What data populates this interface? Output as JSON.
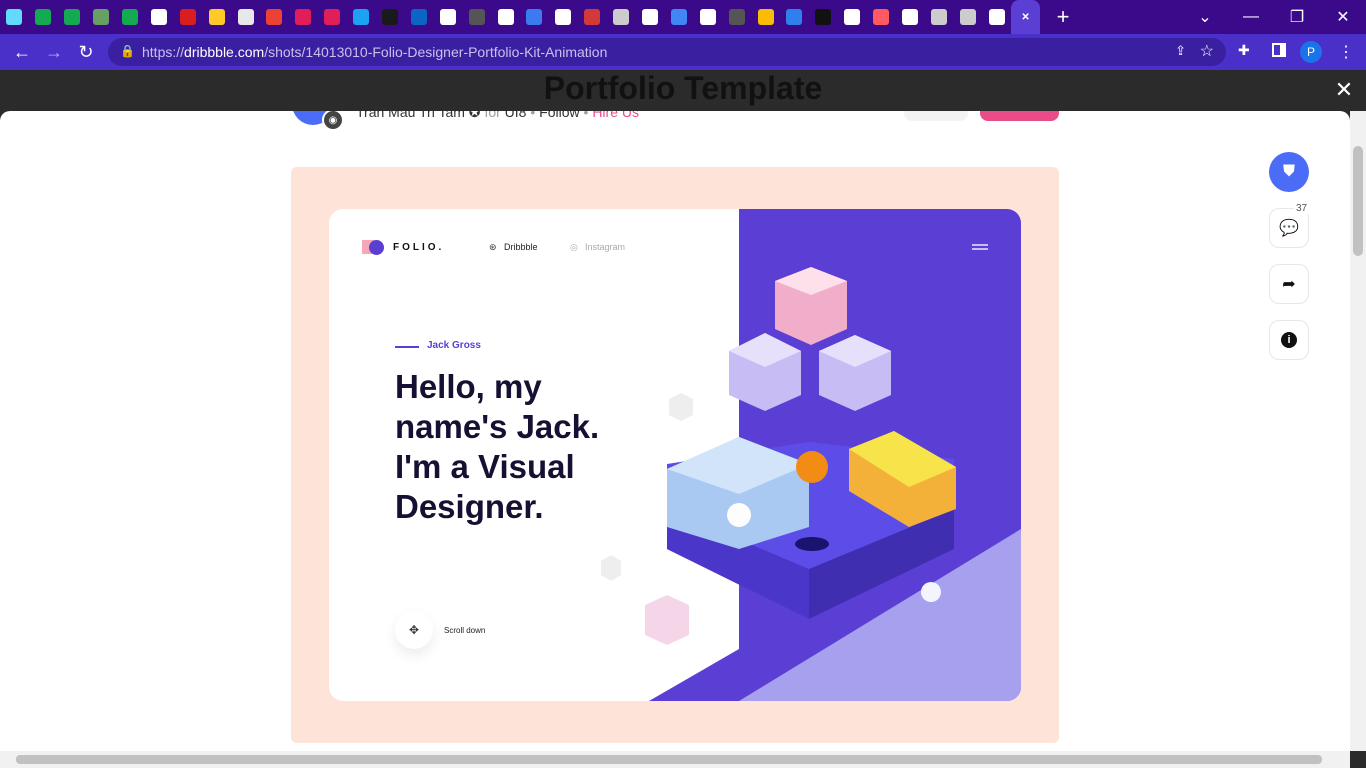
{
  "browser": {
    "url_host": "dribbble.com",
    "url_prefix": "https://",
    "url_path": "/shots/14013010-Folio-Designer-Portfolio-Kit-Animation"
  },
  "tabs": [
    {
      "icon": "react-icon",
      "color": "#61dafb"
    },
    {
      "icon": "mongodb-icon",
      "color": "#13aa52"
    },
    {
      "icon": "mongodb-icon",
      "color": "#13aa52"
    },
    {
      "icon": "nodejs-icon",
      "color": "#68a063"
    },
    {
      "icon": "mongodb-icon",
      "color": "#13aa52"
    },
    {
      "icon": "google-icon",
      "color": "#ffffff"
    },
    {
      "icon": "netlify-icon",
      "color": "#d81e1e"
    },
    {
      "icon": "firebase-icon",
      "color": "#ffca28"
    },
    {
      "icon": "store-icon",
      "color": "#e8e8e8"
    },
    {
      "icon": "gmail-icon",
      "color": "#ea4335"
    },
    {
      "icon": "slack-icon",
      "color": "#e01e5a"
    },
    {
      "icon": "slack-icon",
      "color": "#e01e5a"
    },
    {
      "icon": "twitter-icon",
      "color": "#1da1f2"
    },
    {
      "icon": "github-icon",
      "color": "#1a1a1a"
    },
    {
      "icon": "linkedin-icon",
      "color": "#0a66c2"
    },
    {
      "icon": "globe-icon",
      "color": "#ffffff"
    },
    {
      "icon": "github-icon",
      "color": "#555555"
    },
    {
      "icon": "circle-icon",
      "color": "#ffffff"
    },
    {
      "icon": "p-icon",
      "color": "#3a7bf0"
    },
    {
      "icon": "m-icon",
      "color": "#ffffff"
    },
    {
      "icon": "codepen-icon",
      "color": "#d23a3a"
    },
    {
      "icon": "hacker-icon",
      "color": "#cccccc"
    },
    {
      "icon": "codesandbox-icon",
      "color": "#ffffff"
    },
    {
      "icon": "docs-icon",
      "color": "#4285f4"
    },
    {
      "icon": "book-icon",
      "color": "#ffffff"
    },
    {
      "icon": "github-icon",
      "color": "#555555"
    },
    {
      "icon": "drive-icon",
      "color": "#fbbc05"
    },
    {
      "icon": "c-icon",
      "color": "#2f80ed"
    },
    {
      "icon": "android-icon",
      "color": "#111111"
    },
    {
      "icon": "google-icon",
      "color": "#ffffff"
    },
    {
      "icon": "asterisk-icon",
      "color": "#ff5a5f"
    },
    {
      "icon": "flag-icon",
      "color": "#ffffff"
    },
    {
      "icon": "hacker-icon",
      "color": "#cccccc"
    },
    {
      "icon": "globe-icon",
      "color": "#cccccc"
    },
    {
      "icon": "medium-icon",
      "color": "#ffffff"
    },
    {
      "icon": "close-icon",
      "color": "#ffffff"
    }
  ],
  "header": {
    "title": "Portfolio Template",
    "author": "Tran Mau Tri Tam",
    "for": "for",
    "team": "UI8",
    "follow": "Follow",
    "hire": "Hire Us"
  },
  "shot": {
    "brand": "FOLIO.",
    "nav1": "Dribbble",
    "nav2": "Instagram",
    "tagline": "Jack Gross",
    "headline": [
      "Hello, my",
      "name's Jack.",
      "I'm a Visual",
      "Designer."
    ],
    "scroll": "Scroll down"
  },
  "sidebar": {
    "comments": "37"
  },
  "colors": {
    "accent": "#5b3fd4",
    "hire": "#ea4c89",
    "shotbg": "#fde3d8"
  }
}
